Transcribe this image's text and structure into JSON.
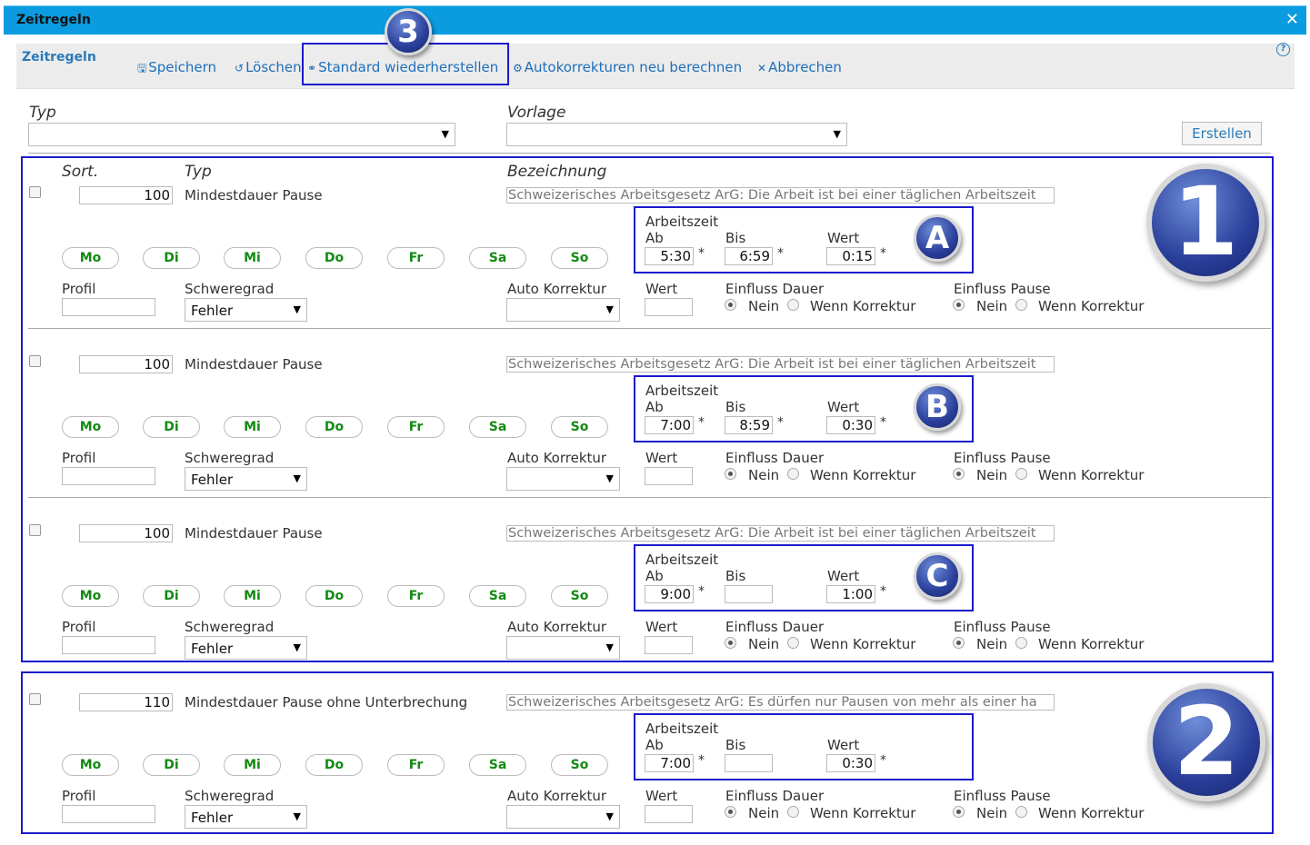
{
  "window": {
    "title": "Zeitregeln",
    "close_symbol": "✕"
  },
  "toolbar": {
    "title": "Zeitregeln",
    "save": "Speichern",
    "delete": "Löschen",
    "restore": "Standard wiederherstellen",
    "recalc": "Autokorrekturen neu berechnen",
    "cancel": "Abbrechen",
    "help": "?"
  },
  "filters": {
    "type_label": "Typ",
    "template_label": "Vorlage",
    "create_button": "Erstellen"
  },
  "headers": {
    "sort": "Sort.",
    "type": "Typ",
    "description": "Bezeichnung"
  },
  "labels": {
    "arbeitszeit": "Arbeitszeit",
    "ab": "Ab",
    "bis": "Bis",
    "wert": "Wert",
    "profil": "Profil",
    "schweregrad": "Schweregrad",
    "auto_korrektur": "Auto Korrektur",
    "einfluss_dauer": "Einfluss Dauer",
    "einfluss_pause": "Einfluss Pause",
    "nein": "Nein",
    "wenn_korrektur": "Wenn Korrektur",
    "asterisk": "*"
  },
  "days": [
    "Mo",
    "Di",
    "Mi",
    "Do",
    "Fr",
    "Sa",
    "So"
  ],
  "rules": [
    {
      "sort": "100",
      "type": "Mindestdauer Pause",
      "description": "Schweizerisches Arbeitsgesetz ArG: Die Arbeit ist bei einer täglichen Arbeitszeit",
      "ab": "5:30",
      "bis": "6:59",
      "wert": "0:15",
      "severity": "Fehler"
    },
    {
      "sort": "100",
      "type": "Mindestdauer Pause",
      "description": "Schweizerisches Arbeitsgesetz ArG: Die Arbeit ist bei einer täglichen Arbeitszeit",
      "ab": "7:00",
      "bis": "8:59",
      "wert": "0:30",
      "severity": "Fehler"
    },
    {
      "sort": "100",
      "type": "Mindestdauer Pause",
      "description": "Schweizerisches Arbeitsgesetz ArG: Die Arbeit ist bei einer täglichen Arbeitszeit",
      "ab": "9:00",
      "bis": "",
      "wert": "1:00",
      "severity": "Fehler"
    },
    {
      "sort": "110",
      "type": "Mindestdauer Pause ohne Unterbrechung",
      "description": "Schweizerisches Arbeitsgesetz ArG: Es dürfen nur Pausen von mehr als einer ha",
      "ab": "7:00",
      "bis": "",
      "wert": "0:30",
      "severity": "Fehler"
    }
  ],
  "annotations": {
    "big1": "1",
    "big2": "2",
    "badge3": "3",
    "a": "A",
    "b": "B",
    "c": "C"
  },
  "colors": {
    "titlebar": "#0a9be0",
    "link": "#1f6fba",
    "day_text": "#138a13",
    "frame": "#1a1acc"
  }
}
